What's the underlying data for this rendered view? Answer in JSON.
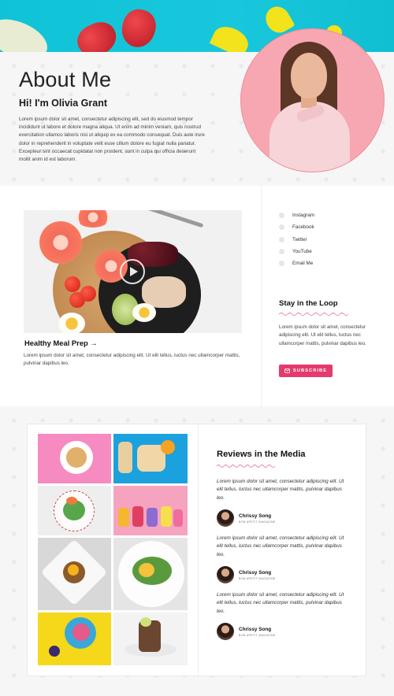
{
  "about": {
    "title": "About Me",
    "greeting": "Hi! I'm Olivia Grant",
    "body": "Lorem ipsum dolor sit amet, consectetur adipiscing elit, sed do eiusmod tempor incididunt ut labore et dolore magna aliqua. Ut enim ad minim veniam, quis nostrud exercitation ullamco laboris nisi ut aliquip ex ea commodo consequat. Duis aute irure dolor in reprehenderit in voluptate velit esse cillum dolore eu fugiat nulla pariatur. Excepteur sint occaecat cupidatat non proident, sunt in culpa qui officia deserunt mollit anim id est laborum."
  },
  "post": {
    "title": "Healthy Meal Prep →",
    "excerpt": "Lorem ipsum dolor sit amet, consectetur adipiscing elit. Ut elit tellus, luctus nec ullamcorper mattis, pulvinar dapibus leo."
  },
  "sidebar": {
    "social": [
      {
        "label": "Instagram",
        "icon": "instagram-icon"
      },
      {
        "label": "Facebook",
        "icon": "facebook-icon"
      },
      {
        "label": "Twitter",
        "icon": "twitter-icon"
      },
      {
        "label": "YouTube",
        "icon": "youtube-icon"
      },
      {
        "label": "Email Me",
        "icon": "email-icon"
      }
    ],
    "loop_title": "Stay in the Loop",
    "loop_text": "Lorem ipsum dolor sit amet, consectetur adipiscing elit. Ut elit tellus, luctus nec ullamcorper mattis, pulvinar dapibus leo.",
    "subscribe_label": "SUBSCRIBE"
  },
  "reviews": {
    "title": "Reviews in the Media",
    "items": [
      {
        "quote": "Lorem ipsum dolor sit amet, consectetur adipiscing elit. Ut elit tellus, luctus nec ullamcorper mattis, pulvinar dapibus leo.",
        "name": "Chrissy Song",
        "org": "BON APETIT MAGAZINE"
      },
      {
        "quote": "Lorem ipsum dolor sit amet, consectetur adipiscing elit. Ut elit tellus, luctus nec ullamcorper mattis, pulvinar dapibus leo.",
        "name": "Chrissy Song",
        "org": "BON APETIT MAGAZINE"
      },
      {
        "quote": "Lorem ipsum dolor sit amet, consectetur adipiscing elit. Ut elit tellus, luctus nec ullamcorper mattis, pulvinar dapibus leo.",
        "name": "Chrissy Song",
        "org": "BON APETIT MAGAZINE"
      }
    ]
  },
  "colors": {
    "accent": "#e43a6e",
    "banner": "#19c7dc",
    "portrait_bg": "#f7a7b1"
  }
}
